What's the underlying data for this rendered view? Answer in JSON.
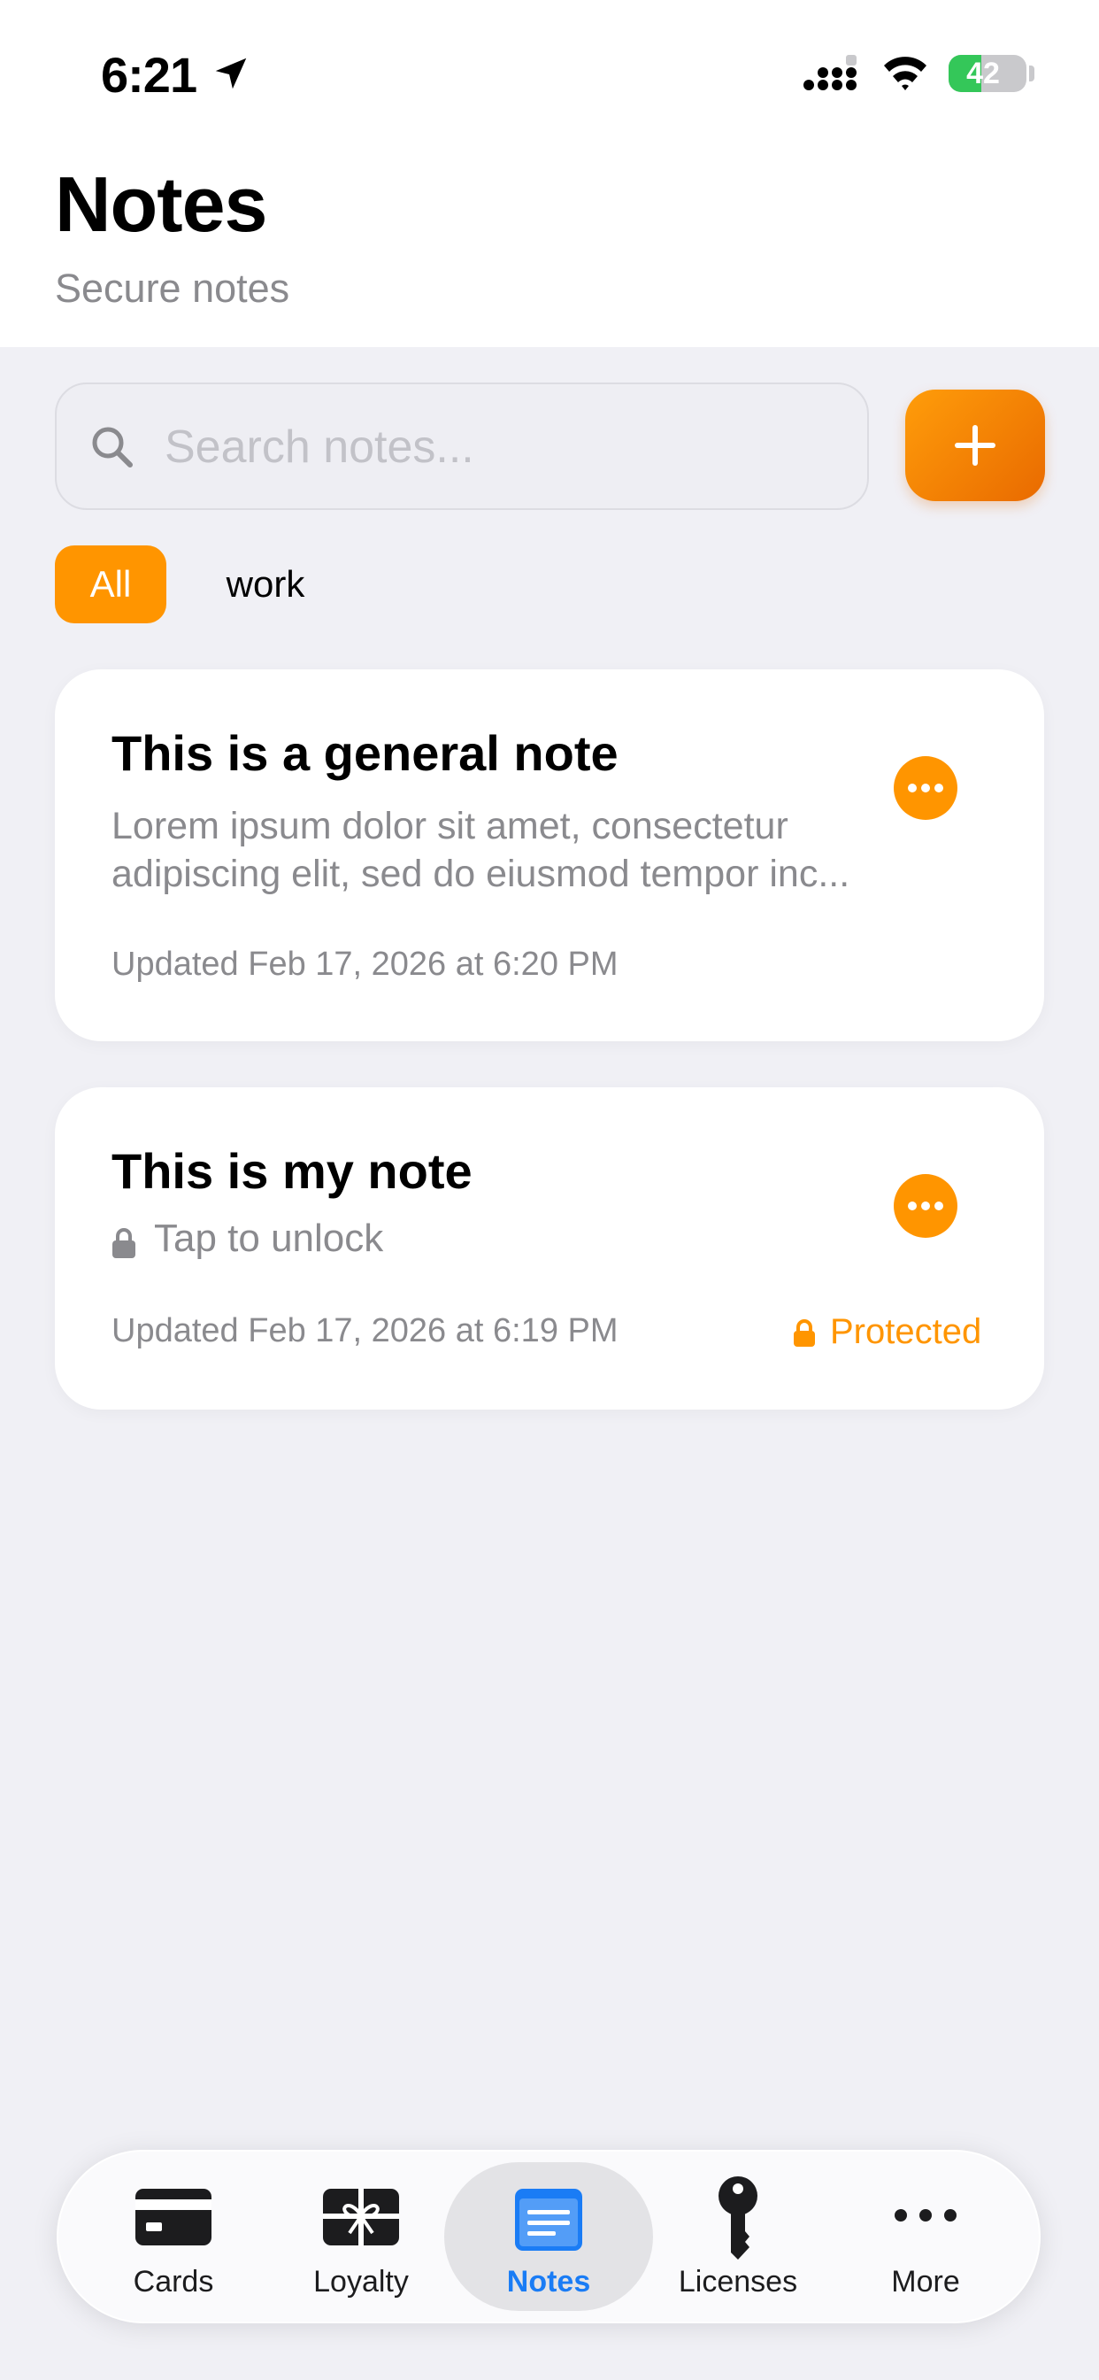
{
  "status_bar": {
    "time": "6:21",
    "battery": "42"
  },
  "header": {
    "title": "Notes",
    "subtitle": "Secure notes"
  },
  "search": {
    "placeholder": "Search notes...",
    "value": ""
  },
  "add_button": {
    "icon": "plus-icon"
  },
  "filters": [
    {
      "label": "All",
      "selected": true
    },
    {
      "label": "work",
      "selected": false
    }
  ],
  "notes": [
    {
      "title": "This is a general note",
      "preview": "Lorem ipsum dolor sit amet, consectetur adipiscing elit, sed do eiusmod tempor inc...",
      "updated": "Updated Feb 17, 2026 at 6:20 PM"
    },
    {
      "title": "This is my note",
      "locked_text": "Tap to unlock",
      "updated": "Updated Feb 17, 2026 at 6:19 PM",
      "badge": "Protected"
    }
  ],
  "tabbar": {
    "tabs": [
      {
        "label": "Cards",
        "icon": "credit-card-icon"
      },
      {
        "label": "Loyalty",
        "icon": "gift-card-icon"
      },
      {
        "label": "Notes",
        "icon": "notes-icon",
        "active": true
      },
      {
        "label": "Licenses",
        "icon": "key-icon"
      },
      {
        "label": "More",
        "icon": "ellipsis-icon"
      }
    ]
  },
  "colors": {
    "accent": "#ff9500",
    "active_tab": "#1a7cf5",
    "background": "#f0f0f5",
    "secondary_text": "#8a8a8e"
  }
}
